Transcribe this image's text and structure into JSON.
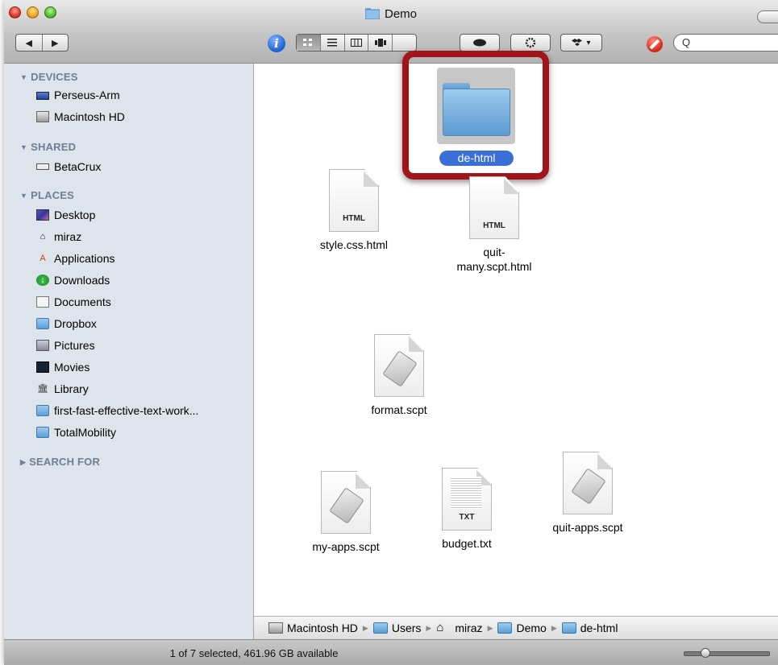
{
  "window": {
    "title": "Demo"
  },
  "toolbar": {
    "back_glyph": "◀",
    "forward_glyph": "▶",
    "info_glyph": "i",
    "view_icons": [
      "icon-view-icon",
      "list-view-icon",
      "column-view-icon",
      "coverflow-view-icon"
    ],
    "search_glyph": "Q",
    "dropbox_glyph": "▾"
  },
  "sidebar": {
    "devices_header": "DEVICES",
    "devices": [
      "Perseus-Arm",
      "Macintosh HD"
    ],
    "shared_header": "SHARED",
    "shared": [
      "BetaCrux"
    ],
    "places_header": "PLACES",
    "places": [
      "Desktop",
      "miraz",
      "Applications",
      "Downloads",
      "Documents",
      "Dropbox",
      "Pictures",
      "Movies",
      "Library",
      "first-fast-effective-text-work...",
      "TotalMobility"
    ],
    "search_header": "SEARCH FOR"
  },
  "files": {
    "selected_folder": "de-html",
    "style_css": {
      "name": "style.css.html",
      "ext": "HTML"
    },
    "quit_many": {
      "name_line1": "quit-",
      "name_line2": "many.scpt.html",
      "ext": "HTML"
    },
    "format": {
      "name": "format.scpt"
    },
    "my_apps": {
      "name": "my-apps.scpt"
    },
    "budget": {
      "name": "budget.txt",
      "ext": "TXT"
    },
    "quit_apps": {
      "name": "quit-apps.scpt"
    }
  },
  "pathbar": [
    "Macintosh HD",
    "Users",
    "miraz",
    "Demo",
    "de-html"
  ],
  "status": {
    "text": "1 of 7 selected, 461.96 GB available"
  },
  "colors": {
    "highlight": "#a1141a",
    "selection": "#3a6fd8",
    "sidebar_bg": "#dde4ec"
  }
}
